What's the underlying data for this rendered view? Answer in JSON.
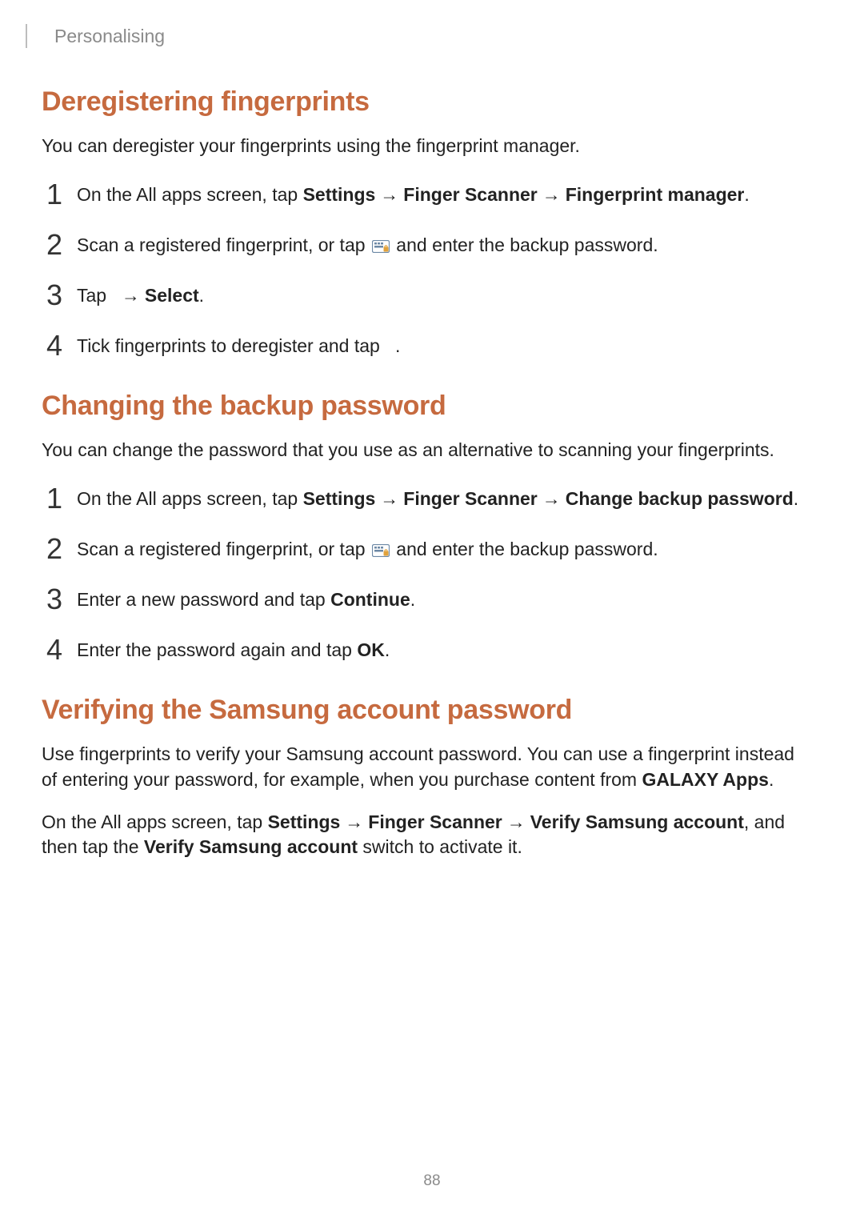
{
  "header": {
    "breadcrumb": "Personalising"
  },
  "section1": {
    "heading": "Deregistering fingerprints",
    "intro": "You can deregister your fingerprints using the fingerprint manager.",
    "step1": {
      "pre": "On the All apps screen, tap ",
      "b1": "Settings",
      "arrow1": "→",
      "b2": "Finger Scanner",
      "arrow2": "→",
      "b3": "Fingerprint manager",
      "post": "."
    },
    "step2": {
      "pre": "Scan a registered fingerprint, or tap ",
      "post": " and enter the backup password."
    },
    "step3": {
      "pre": "Tap ",
      "arrow": "→",
      "b1": "Select",
      "post": "."
    },
    "step4": {
      "pre": "Tick fingerprints to deregister and tap ",
      "post": "."
    }
  },
  "section2": {
    "heading": "Changing the backup password",
    "intro": "You can change the password that you use as an alternative to scanning your fingerprints.",
    "step1": {
      "pre": "On the All apps screen, tap ",
      "b1": "Settings",
      "arrow1": "→",
      "b2": "Finger Scanner",
      "arrow2": "→",
      "b3": "Change backup password",
      "post": "."
    },
    "step2": {
      "pre": "Scan a registered fingerprint, or tap ",
      "post": " and enter the backup password."
    },
    "step3": {
      "pre": "Enter a new password and tap ",
      "b1": "Continue",
      "post": "."
    },
    "step4": {
      "pre": "Enter the password again and tap ",
      "b1": "OK",
      "post": "."
    }
  },
  "section3": {
    "heading": "Verifying the Samsung account password",
    "para1": {
      "pre": "Use fingerprints to verify your Samsung account password. You can use a fingerprint instead of entering your password, for example, when you purchase content from ",
      "b1": "GALAXY Apps",
      "post": "."
    },
    "para2": {
      "pre": "On the All apps screen, tap ",
      "b1": "Settings",
      "arrow1": "→",
      "b2": "Finger Scanner",
      "arrow2": "→",
      "b3": "Verify Samsung account",
      "mid": ", and then tap the ",
      "b4": "Verify Samsung account",
      "post": " switch to activate it."
    }
  },
  "page_number": "88",
  "nums": {
    "n1": "1",
    "n2": "2",
    "n3": "3",
    "n4": "4"
  }
}
